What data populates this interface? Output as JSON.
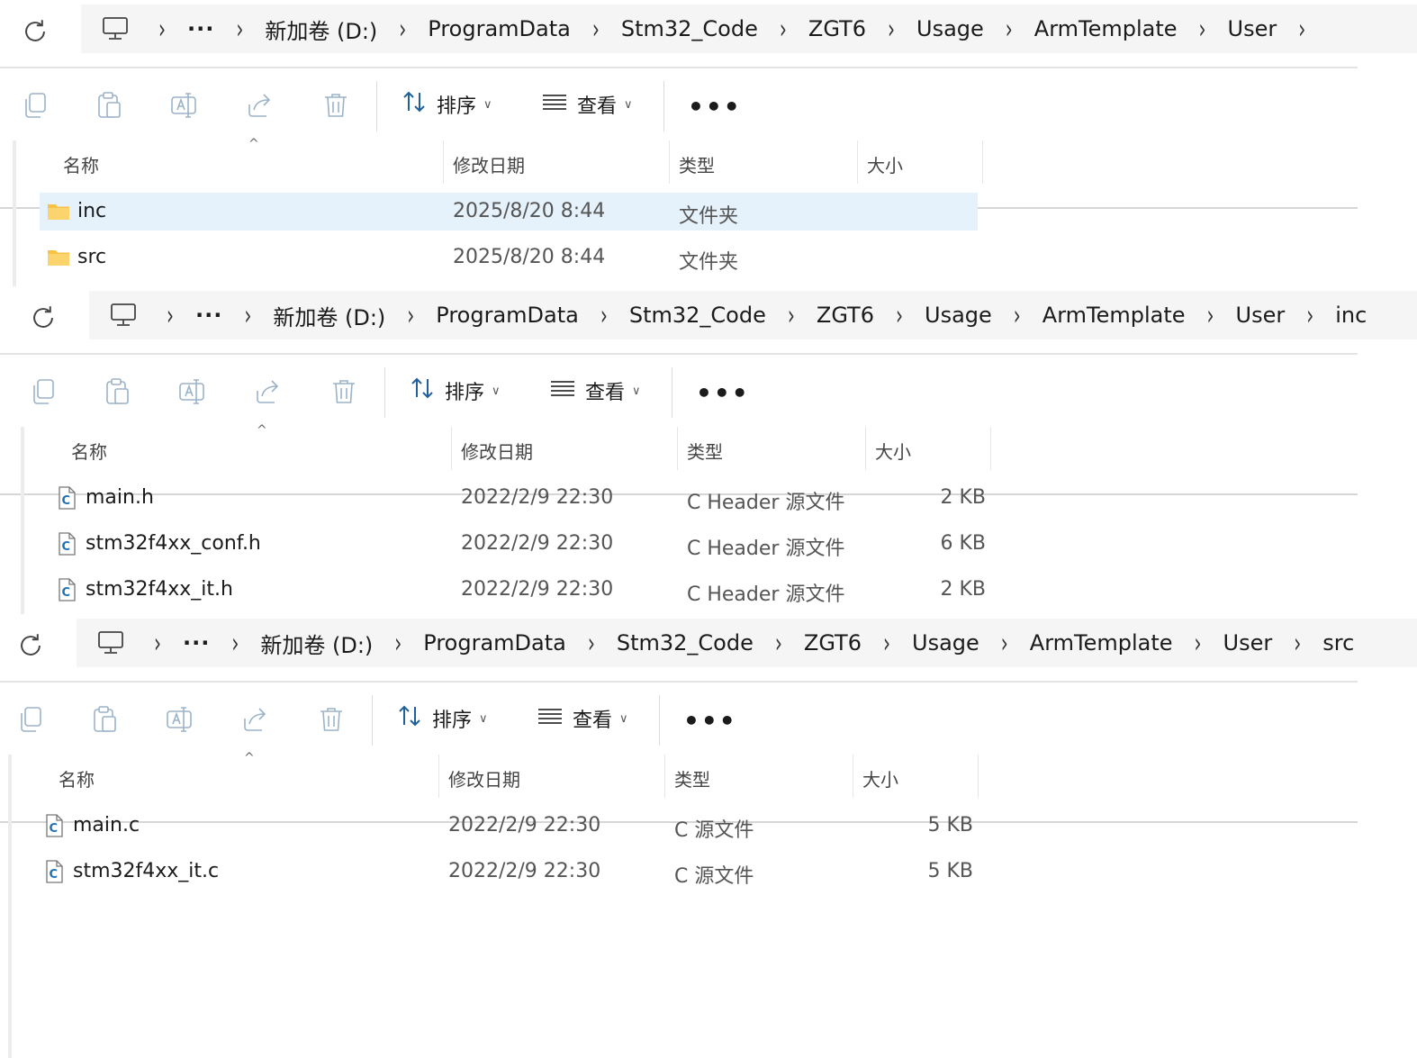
{
  "breadcrumb_common": [
    "新加卷 (D:)",
    "ProgramData",
    "Stm32_Code",
    "ZGT6",
    "Usage",
    "ArmTemplate",
    "User"
  ],
  "panels": [
    {
      "crumbs": [
        "新加卷 (D:)",
        "ProgramData",
        "Stm32_Code",
        "ZGT6",
        "Usage",
        "ArmTemplate",
        "User"
      ],
      "trailing_chevron": true,
      "rows": [
        {
          "name": "inc",
          "date": "2025/8/20 8:44",
          "type": "文件夹",
          "size": "",
          "icon": "folder-icon",
          "selected": true
        },
        {
          "name": "src",
          "date": "2025/8/20 8:44",
          "type": "文件夹",
          "size": "",
          "icon": "folder-icon",
          "selected": false
        }
      ]
    },
    {
      "crumbs": [
        "新加卷 (D:)",
        "ProgramData",
        "Stm32_Code",
        "ZGT6",
        "Usage",
        "ArmTemplate",
        "User",
        "inc"
      ],
      "trailing_chevron": false,
      "rows": [
        {
          "name": "main.h",
          "date": "2022/2/9 22:30",
          "type": "C Header 源文件",
          "size": "2 KB",
          "icon": "c-file-icon",
          "selected": false
        },
        {
          "name": "stm32f4xx_conf.h",
          "date": "2022/2/9 22:30",
          "type": "C Header 源文件",
          "size": "6 KB",
          "icon": "c-file-icon",
          "selected": false
        },
        {
          "name": "stm32f4xx_it.h",
          "date": "2022/2/9 22:30",
          "type": "C Header 源文件",
          "size": "2 KB",
          "icon": "c-file-icon",
          "selected": false
        }
      ]
    },
    {
      "crumbs": [
        "新加卷 (D:)",
        "ProgramData",
        "Stm32_Code",
        "ZGT6",
        "Usage",
        "ArmTemplate",
        "User",
        "src"
      ],
      "trailing_chevron": false,
      "rows": [
        {
          "name": "main.c",
          "date": "2022/2/9 22:30",
          "type": "C 源文件",
          "size": "5 KB",
          "icon": "c-file-icon",
          "selected": false
        },
        {
          "name": "stm32f4xx_it.c",
          "date": "2022/2/9 22:30",
          "type": "C 源文件",
          "size": "5 KB",
          "icon": "c-file-icon",
          "selected": false
        }
      ]
    }
  ],
  "toolbar": {
    "sort_label": "排序",
    "view_label": "查看",
    "more_label": "•••"
  },
  "columns": {
    "name": "名称",
    "date": "修改日期",
    "type": "类型",
    "size": "大小"
  },
  "ellipsis": "···",
  "colors": {
    "selected_row": "#e5f1fb",
    "crumb_bg": "#f5f5f5",
    "folder": "#f6c344"
  }
}
